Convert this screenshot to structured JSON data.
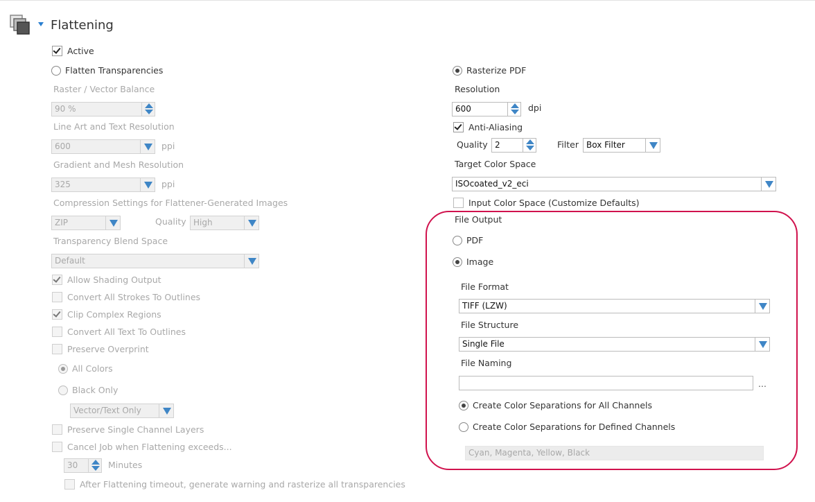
{
  "header": {
    "title": "Flattening"
  },
  "left": {
    "active": "Active",
    "flatten": "Flatten Transparencies",
    "raster_vector_label": "Raster / Vector Balance",
    "raster_vector_value": "90 %",
    "lineart_label": "Line Art and Text Resolution",
    "lineart_value": "600",
    "lineart_unit": "ppi",
    "gradient_label": "Gradient and Mesh Resolution",
    "gradient_value": "325",
    "gradient_unit": "ppi",
    "compression_label": "Compression Settings for Flattener-Generated Images",
    "compression_value": "ZIP",
    "quality_label": "Quality",
    "quality_value": "High",
    "blend_label": "Transparency Blend Space",
    "blend_value": "Default",
    "allow_shading": "Allow Shading Output",
    "convert_strokes": "Convert All Strokes To Outlines",
    "clip_regions": "Clip Complex Regions",
    "convert_text": "Convert All Text To Outlines",
    "preserve_overprint": "Preserve Overprint",
    "all_colors": "All Colors",
    "black_only": "Black Only",
    "black_only_value": "Vector/Text Only",
    "preserve_single": "Preserve Single Channel Layers",
    "cancel_job": "Cancel Job when Flattening exceeds...",
    "minutes_value": "30",
    "minutes_label": "Minutes",
    "after_timeout": "After Flattening timeout, generate warning and rasterize all transparencies"
  },
  "right": {
    "rasterize": "Rasterize PDF",
    "resolution_label": "Resolution",
    "resolution_value": "600",
    "resolution_unit": "dpi",
    "anti_aliasing": "Anti-Aliasing",
    "quality_label": "Quality",
    "quality_value": "2",
    "filter_label": "Filter",
    "filter_value": "Box Filter",
    "target_label": "Target Color Space",
    "target_value": "ISOcoated_v2_eci",
    "input_color": "Input Color Space (Customize Defaults)",
    "file_output_label": "File Output",
    "pdf": "PDF",
    "image": "Image",
    "file_format_label": "File Format",
    "file_format_value": "TIFF (LZW)",
    "file_structure_label": "File Structure",
    "file_structure_value": "Single File",
    "file_naming_label": "File Naming",
    "file_naming_value": "",
    "browse": "...",
    "sep_all": "Create Color Separations for All Channels",
    "sep_defined": "Create Color Separations for Defined Channels",
    "channels_value": "Cyan, Magenta, Yellow, Black"
  },
  "colors": {
    "accent": "#3f86c6",
    "highlight": "#d0124d"
  }
}
